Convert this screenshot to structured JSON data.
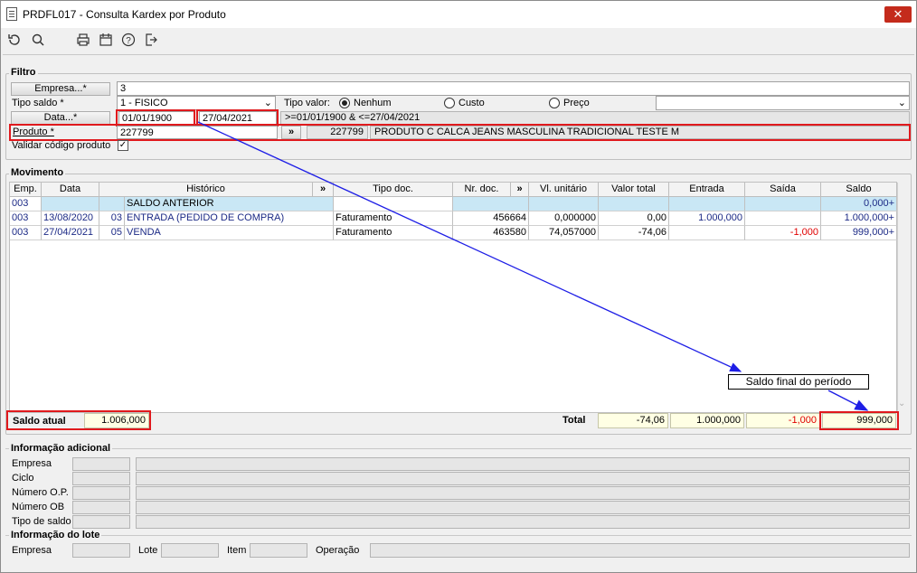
{
  "window": {
    "title": "PRDFL017 - Consulta Kardex por Produto",
    "close_glyph": "✕"
  },
  "toolbar": {
    "icons": [
      "refresh-icon",
      "search-icon",
      "print-icon",
      "calendar-icon",
      "help-icon",
      "exit-icon"
    ]
  },
  "filtro": {
    "legend": "Filtro",
    "empresa_btn": "Empresa...*",
    "empresa_value": "3",
    "tipo_saldo_label": "Tipo saldo *",
    "tipo_saldo_value": "1 - FISICO",
    "tipo_valor_label": "Tipo valor:",
    "radio_nenhum": "Nenhum",
    "radio_custo": "Custo",
    "radio_preco": "Preço",
    "data_btn": "Data...*",
    "data_inicio": "01/01/1900",
    "data_fim": "27/04/2021",
    "data_expr": ">=01/01/1900 & <=27/04/2021",
    "produto_label": "Produto *",
    "produto_value": "227799",
    "produto_more": "»",
    "produto_code": "227799",
    "produto_desc": "PRODUTO C CALCA JEANS MASCULINA TRADICIONAL TESTE M",
    "validar_label": "Validar código produto",
    "validar_checked": true
  },
  "movimento": {
    "legend": "Movimento",
    "columns": [
      "Emp.",
      "Data",
      "Histórico",
      "»",
      "Tipo doc.",
      "Nr. doc.",
      "»",
      "Vl. unitário",
      "Valor total",
      "Entrada",
      "Saída",
      "Saldo"
    ],
    "rows": [
      {
        "emp": "003",
        "data": "",
        "cod": "",
        "hist": "SALDO ANTERIOR",
        "tipo": "",
        "nr": "",
        "vl_unit": "",
        "valor_total": "",
        "entrada": "",
        "saida": "",
        "saldo": "0,000+"
      },
      {
        "emp": "003",
        "data": "13/08/2020",
        "cod": "03",
        "hist": "ENTRADA  (PEDIDO DE COMPRA)",
        "tipo": "Faturamento",
        "nr": "456664",
        "vl_unit": "0,000000",
        "valor_total": "0,00",
        "entrada": "1.000,000",
        "saida": "",
        "saldo": "1.000,000+"
      },
      {
        "emp": "003",
        "data": "27/04/2021",
        "cod": "05",
        "hist": "VENDA",
        "tipo": "Faturamento",
        "nr": "463580",
        "vl_unit": "74,057000",
        "valor_total": "-74,06",
        "entrada": "",
        "saida": "-1,000",
        "saldo": "999,000+"
      }
    ],
    "saldo_atual_label": "Saldo atual",
    "saldo_atual_value": "1.006,000",
    "total_label": "Total",
    "total_valor": "-74,06",
    "total_entrada": "1.000,000",
    "total_saida": "-1,000",
    "total_saldo": "999,000",
    "callout": "Saldo final do período"
  },
  "info": {
    "legend": "Informação adicional",
    "labels": [
      "Empresa",
      "Ciclo",
      "Número O.P.",
      "Número OB",
      "Tipo de saldo"
    ]
  },
  "lote": {
    "legend": "Informação do lote",
    "empresa": "Empresa",
    "lote": "Lote",
    "item": "Item",
    "operacao": "Operação"
  },
  "colors": {
    "highlight": "#e0191d",
    "arrow": "#1e1ee6",
    "selected_row": "#c9e7f5"
  }
}
